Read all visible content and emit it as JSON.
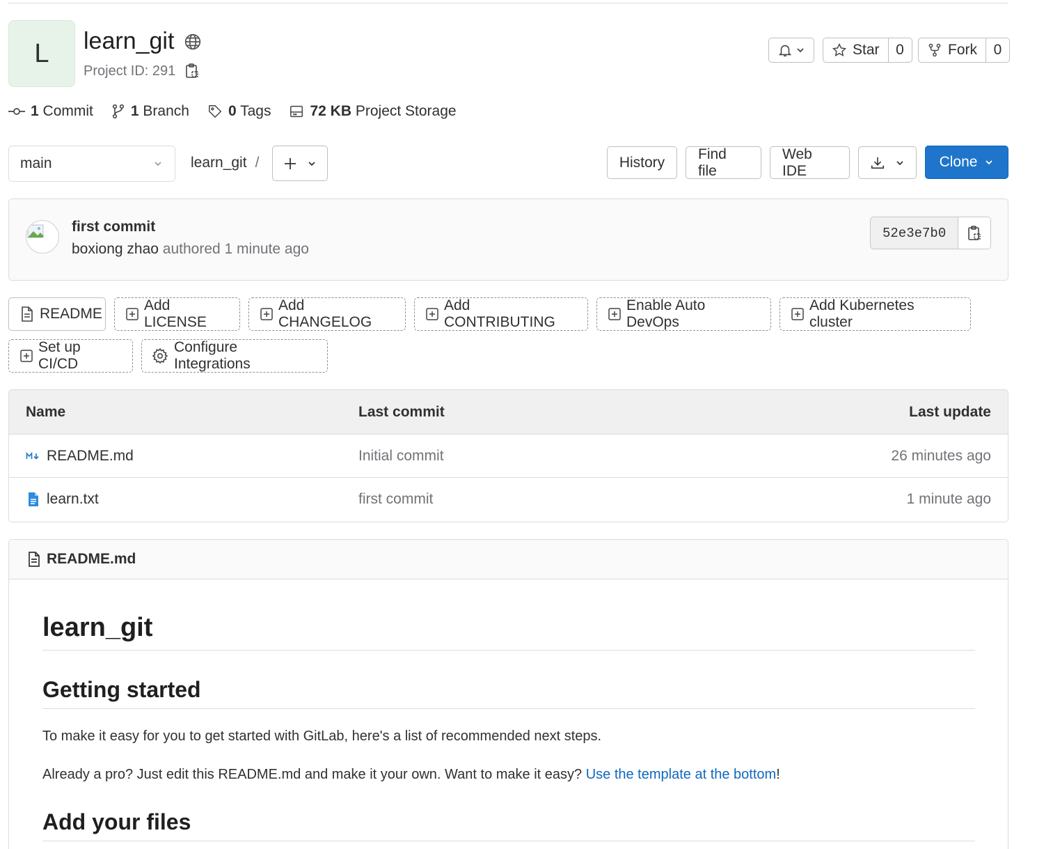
{
  "project": {
    "initial": "L",
    "name": "learn_git",
    "id_text": "Project ID: 291"
  },
  "actions": {
    "star_label": "Star",
    "star_count": "0",
    "fork_label": "Fork",
    "fork_count": "0"
  },
  "stats": {
    "commits_count": "1",
    "commits_label": "Commit",
    "branches_count": "1",
    "branches_label": "Branch",
    "tags_count": "0",
    "tags_label": "Tags",
    "storage_size": "72 KB",
    "storage_label": "Project Storage"
  },
  "toolbar": {
    "branch": "main",
    "breadcrumb_project": "learn_git",
    "breadcrumb_sep": "/",
    "history": "History",
    "find_file": "Find file",
    "web_ide": "Web IDE",
    "clone": "Clone"
  },
  "last_commit": {
    "title": "first commit",
    "author": "boxiong zhao",
    "meta": "authored 1 minute ago",
    "sha": "52e3e7b0"
  },
  "quick_actions": [
    "README",
    "Add LICENSE",
    "Add CHANGELOG",
    "Add CONTRIBUTING",
    "Enable Auto DevOps",
    "Add Kubernetes cluster",
    "Set up CI/CD",
    "Configure Integrations"
  ],
  "files": {
    "headers": [
      "Name",
      "Last commit",
      "Last update"
    ],
    "rows": [
      {
        "name": "README.md",
        "commit": "Initial commit",
        "updated": "26 minutes ago",
        "icon": "markdown-icon"
      },
      {
        "name": "learn.txt",
        "commit": "first commit",
        "updated": "1 minute ago",
        "icon": "text-file-icon"
      }
    ]
  },
  "readme": {
    "filename": "README.md",
    "h1": "learn_git",
    "h2_getting_started": "Getting started",
    "p1": "To make it easy for you to get started with GitLab, here's a list of recommended next steps.",
    "p2_prefix": "Already a pro? Just edit this README.md and make it your own. Want to make it easy? ",
    "p2_link": "Use the template at the bottom",
    "p2_suffix": "!",
    "h2_add_files": "Add your files"
  },
  "colors": {
    "accent": "#1f75cb",
    "link": "#1068bf",
    "avatar_bg": "#e7f3e8"
  }
}
